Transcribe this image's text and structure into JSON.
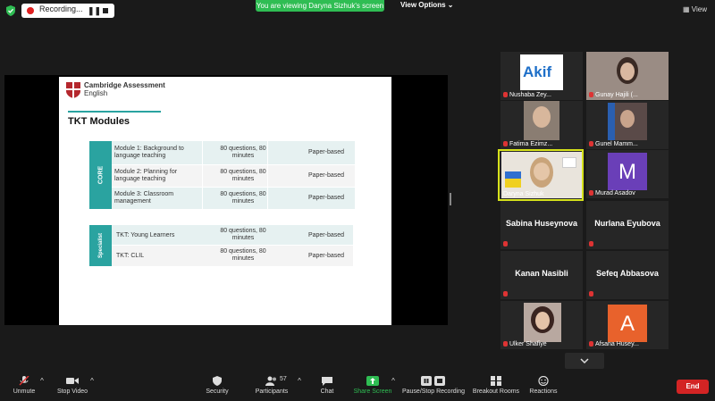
{
  "top_bar": {
    "recording_label": "Recording...",
    "pause_glyph": "❚❚",
    "viewing_banner": "You are viewing Daryna Sizhuk's screen",
    "view_options": "View Options ⌄",
    "view_button": "▦ View"
  },
  "slide": {
    "brand_line1": "Cambridge Assessment",
    "brand_line2": "English",
    "title": "TKT Modules",
    "core_label": "CORE",
    "specialist_label": "Specialist",
    "core_rows": [
      {
        "module": "Module 1: Background to language teaching",
        "questions": "80 questions, 80 minutes",
        "format": "Paper-based"
      },
      {
        "module": "Module 2: Planning for language teaching",
        "questions": "80 questions, 80 minutes",
        "format": "Paper-based"
      },
      {
        "module": "Module 3: Classroom management",
        "questions": "80 questions, 80 minutes",
        "format": "Paper-based"
      }
    ],
    "specialist_rows": [
      {
        "module": "TKT: Young Learners",
        "questions": "80 questions, 80 minutes",
        "format": "Paper-based"
      },
      {
        "module": "TKT: CLIL",
        "questions": "80 questions, 80 minutes",
        "format": "Paper-based"
      }
    ]
  },
  "participants": [
    {
      "name": "Nushaba Zey...",
      "logo": "Akif"
    },
    {
      "name": "Gunay Hajili (..."
    },
    {
      "name": "Fatima Ezimz..."
    },
    {
      "name": "Gunel Mamm..."
    },
    {
      "name": "Daryna Sizhuk"
    },
    {
      "name": "Murad Asadov",
      "initial": "M"
    },
    {
      "name": "Sabina Huseynova"
    },
    {
      "name": "Nurlana Eyubova"
    },
    {
      "name": "Kanan Nasibli"
    },
    {
      "name": "Sefeq Abbasova"
    },
    {
      "name": "Ulker Shafiye"
    },
    {
      "name": "Afsana Husey...",
      "initial": "A"
    }
  ],
  "toolbar": {
    "unmute": "Unmute",
    "stop_video": "Stop Video",
    "security": "Security",
    "participants": "Participants",
    "participants_count": "57",
    "chat": "Chat",
    "share_screen": "Share Screen",
    "pause_stop_recording": "Pause/Stop Recording",
    "breakout_rooms": "Breakout Rooms",
    "reactions": "Reactions",
    "end": "End"
  },
  "colors": {
    "accent_teal": "#2aa3a0",
    "banner_green": "#2fbd53",
    "end_red": "#d32424",
    "highlight_yellow": "#d6e21b"
  }
}
